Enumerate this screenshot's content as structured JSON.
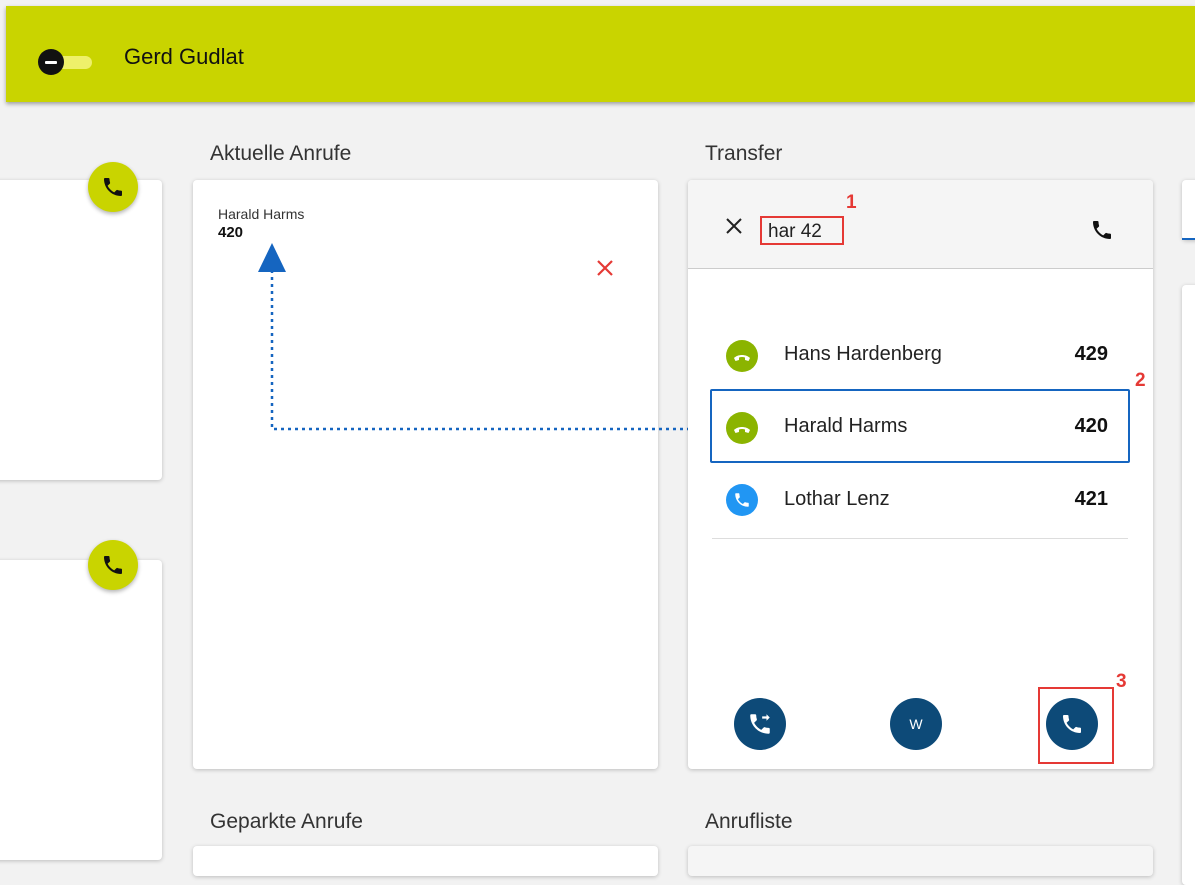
{
  "header": {
    "user_name": "Gerd Gudlat"
  },
  "sections": {
    "current_calls_title": "Aktuelle Anrufe",
    "transfer_title": "Transfer",
    "parked_calls_title": "Geparkte Anrufe",
    "call_list_title": "Anrufliste"
  },
  "current_call": {
    "name": "Harald Harms",
    "extension": "420"
  },
  "transfer": {
    "search_value": "har 42",
    "results": [
      {
        "name": "Hans Hardenberg",
        "extension": "429",
        "status": "available"
      },
      {
        "name": "Harald Harms",
        "extension": "420",
        "status": "available"
      },
      {
        "name": "Lothar Lenz",
        "extension": "421",
        "status": "incoming"
      }
    ],
    "action_w_label": "W"
  },
  "markers": {
    "step1": "1",
    "step2": "2",
    "step3": "3"
  },
  "colors": {
    "header_bg": "#c9d400",
    "accent": "#c9d400",
    "action_blue": "#0d4a78",
    "annotation_red": "#e53935",
    "selection_blue": "#1565c0",
    "status_green": "#8bb400",
    "status_blue": "#2196f3"
  }
}
